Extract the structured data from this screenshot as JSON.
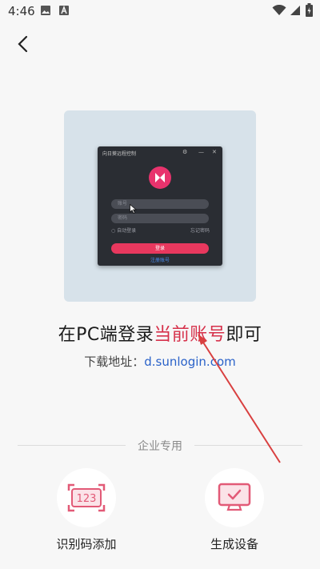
{
  "status_bar": {
    "time": "4:46",
    "icons": [
      "image-icon",
      "a-letter-icon",
      "wifi-icon",
      "signal-icon",
      "battery-icon"
    ]
  },
  "nav": {
    "back_icon": "chevron-left-icon"
  },
  "illustration": {
    "window_title": "向日葵远程控制",
    "account_placeholder": "账号",
    "password_placeholder": "密码",
    "auto_login": "自动登录",
    "forgot_password": "忘记密码",
    "login_button": "登录",
    "register_link": "注册账号"
  },
  "headline": {
    "prefix": "在PC端登录",
    "highlight": "当前账号",
    "suffix": "即可"
  },
  "download": {
    "label": "下载地址：",
    "url": "d.sunlogin.com"
  },
  "enterprise": {
    "section_label": "企业专用",
    "actions": [
      {
        "label": "识别码添加",
        "icon": "id-code-icon",
        "code_text": "123"
      },
      {
        "label": "生成设备",
        "icon": "monitor-check-icon"
      }
    ]
  },
  "colors": {
    "accent": "#d6304a",
    "link": "#2a62c9",
    "icon_pink": "#e25a77",
    "annotation_arrow": "#d94040"
  }
}
